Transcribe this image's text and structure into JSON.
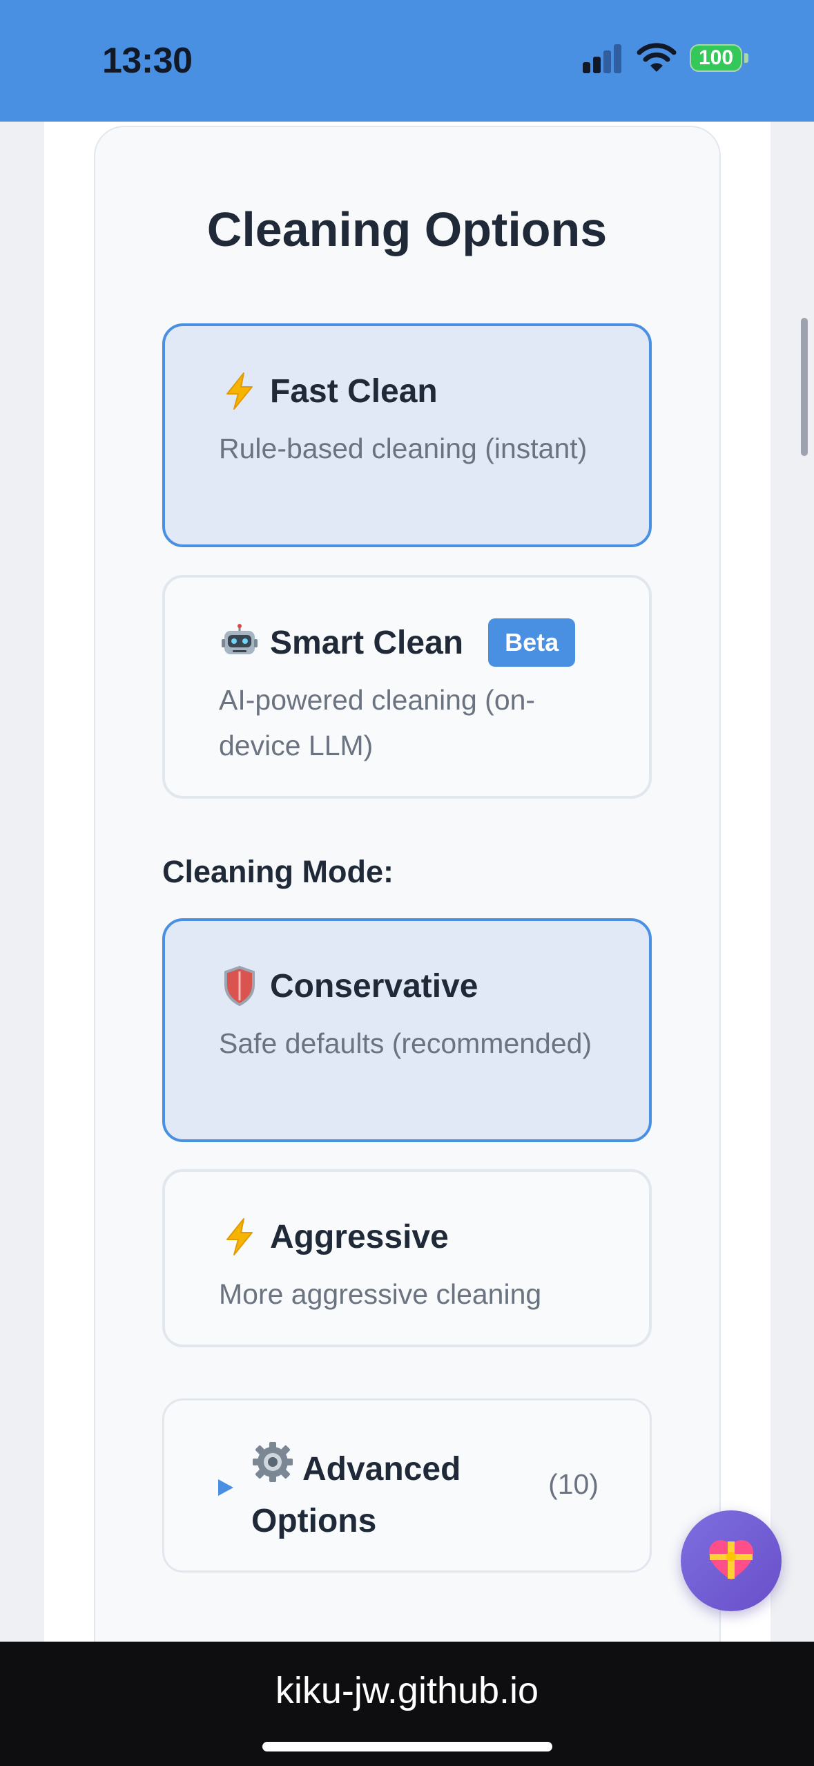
{
  "status_bar": {
    "time": "13:30",
    "battery": "100",
    "signal_icon": "cellular-signal-icon",
    "wifi_icon": "wifi-icon",
    "background": "#4a90e2"
  },
  "card": {
    "title": "Cleaning Options",
    "engine_options": [
      {
        "icon": "lightning-icon",
        "label": "Fast Clean",
        "description": "Rule-based cleaning (instant)",
        "selected": true
      },
      {
        "icon": "robot-icon",
        "label": "Smart Clean",
        "badge": "Beta",
        "description": "AI-powered cleaning (on-device LLM)",
        "selected": false
      }
    ],
    "mode_label": "Cleaning Mode:",
    "mode_options": [
      {
        "icon": "shield-icon",
        "label": "Conservative",
        "description": "Safe defaults (recommended)",
        "selected": true
      },
      {
        "icon": "lightning-icon",
        "label": "Aggressive",
        "description": "More aggressive cleaning",
        "selected": false
      }
    ],
    "advanced": {
      "icon": "gear-icon",
      "label": "Advanced Options",
      "count": "(10)",
      "expanded": false
    }
  },
  "fab": {
    "icon": "heart-gift-icon"
  },
  "browser": {
    "url": "kiku-jw.github.io"
  },
  "colors": {
    "accent": "#4a90e2",
    "selected_bg": "#e1e9f7",
    "fab": "#7c6fe0"
  }
}
